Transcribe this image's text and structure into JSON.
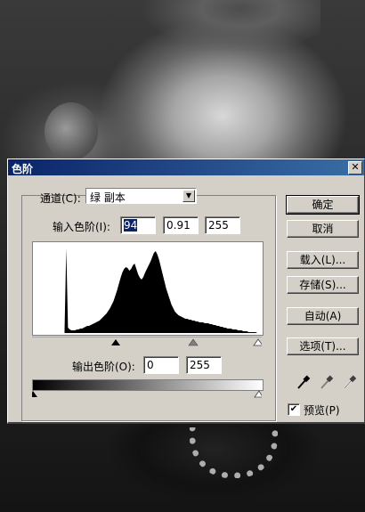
{
  "dialog": {
    "title": "色阶",
    "close_glyph": "✕"
  },
  "channel": {
    "label": "通道(C):",
    "value": "绿 副本"
  },
  "input_levels": {
    "label": "输入色阶(I):",
    "black": "94",
    "gamma": "0.91",
    "white": "255"
  },
  "output_levels": {
    "label": "输出色阶(O):",
    "black": "0",
    "white": "255"
  },
  "buttons": {
    "ok": "确定",
    "cancel": "取消",
    "load": "载入(L)...",
    "save": "存储(S)...",
    "auto": "自动(A)",
    "options": "选项(T)..."
  },
  "preview": {
    "label": "预览(P)",
    "checked": true
  },
  "icons": {
    "black_eyedropper": "eyedropper-black-icon",
    "gray_eyedropper": "eyedropper-gray-icon",
    "white_eyedropper": "eyedropper-white-icon"
  },
  "colors": {
    "title_start": "#0a246a",
    "title_end": "#3a6ea5",
    "panel": "#d4d0c8"
  },
  "histogram": [
    0,
    0,
    0,
    0,
    0,
    0,
    0,
    0,
    0,
    0,
    0,
    0,
    0,
    0,
    0,
    0,
    0,
    0,
    0,
    95,
    6,
    4,
    3,
    3,
    3,
    4,
    4,
    5,
    5,
    6,
    7,
    8,
    8,
    9,
    10,
    11,
    12,
    13,
    14,
    16,
    18,
    20,
    22,
    25,
    28,
    32,
    36,
    42,
    48,
    55,
    62,
    68,
    72,
    74,
    73,
    70,
    72,
    76,
    78,
    72,
    66,
    62,
    60,
    63,
    68,
    72,
    76,
    80,
    85,
    90,
    92,
    88,
    82,
    74,
    66,
    58,
    50,
    44,
    38,
    32,
    28,
    24,
    22,
    20,
    19,
    18,
    17,
    16,
    16,
    15,
    15,
    14,
    14,
    13,
    13,
    12,
    12,
    12,
    11,
    11,
    11,
    10,
    10,
    9,
    9,
    8,
    8,
    7,
    7,
    6,
    6,
    5,
    5,
    5,
    4,
    4,
    4,
    3,
    3,
    3,
    2,
    2,
    2,
    1,
    1,
    1,
    1,
    1,
    0,
    0
  ]
}
